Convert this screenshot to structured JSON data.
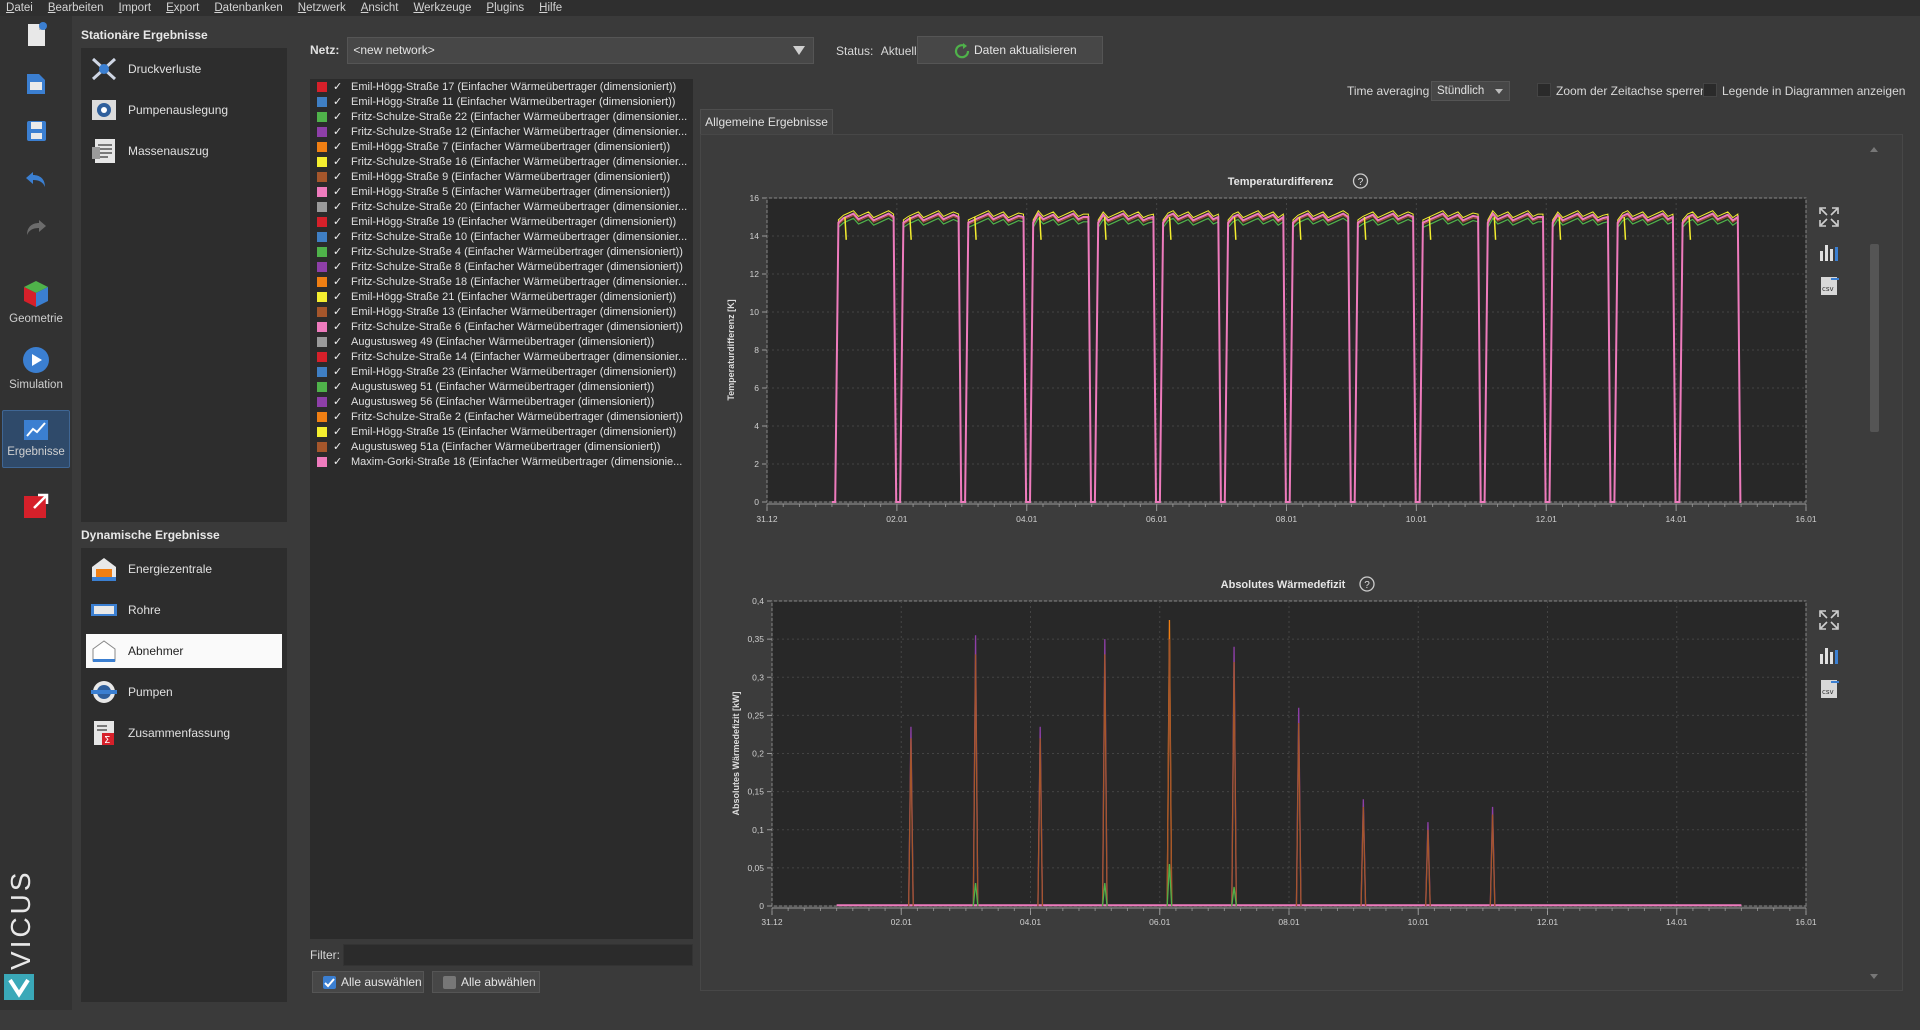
{
  "menu": [
    "Datei",
    "Bearbeiten",
    "Import",
    "Export",
    "Datenbanken",
    "Netzwerk",
    "Ansicht",
    "Werkzeuge",
    "Plugins",
    "Hilfe"
  ],
  "toolbar": {
    "geometry_label": "Geometrie",
    "simulation_label": "Simulation",
    "results_label": "Ergebnisse",
    "logo_text": "VICUS"
  },
  "stationary": {
    "title": "Stationäre Ergebnisse",
    "items": [
      {
        "label": "Druckverluste",
        "icon": "pressure-loss-icon"
      },
      {
        "label": "Pumpenauslegung",
        "icon": "pump-design-icon"
      },
      {
        "label": "Massenauszug",
        "icon": "bill-of-quantities-icon"
      }
    ]
  },
  "dynamic": {
    "title": "Dynamische Ergebnisse",
    "items": [
      {
        "label": "Energiezentrale",
        "icon": "energy-center-icon"
      },
      {
        "label": "Rohre",
        "icon": "pipe-icon"
      },
      {
        "label": "Abnehmer",
        "icon": "consumer-icon",
        "selected": true
      },
      {
        "label": "Pumpen",
        "icon": "pump-icon"
      },
      {
        "label": "Zusammenfassung",
        "icon": "summary-icon"
      }
    ]
  },
  "network": {
    "label": "Netz:",
    "value": "<new network>",
    "status_label": "Status:",
    "status_value": "Aktuell",
    "refresh_label": "Daten aktualisieren"
  },
  "consumers": [
    {
      "name": "Emil-Högg-Straße 17 (Einfacher Wärmeübertrager (dimensioniert))",
      "color": "#d6202a"
    },
    {
      "name": "Emil-Högg-Straße 11 (Einfacher Wärmeübertrager (dimensioniert))",
      "color": "#3f7fc4"
    },
    {
      "name": "Fritz-Schulze-Straße 22 (Einfacher Wärmeübertrager (dimensionier...",
      "color": "#4fb24a"
    },
    {
      "name": "Fritz-Schulze-Straße 12 (Einfacher Wärmeübertrager (dimensionier...",
      "color": "#8e3fa8"
    },
    {
      "name": "Emil-Högg-Straße 7 (Einfacher Wärmeübertrager (dimensioniert))",
      "color": "#f07f13"
    },
    {
      "name": "Fritz-Schulze-Straße 16 (Einfacher Wärmeübertrager (dimensionier...",
      "color": "#f4ee2f"
    },
    {
      "name": "Emil-Högg-Straße 9 (Einfacher Wärmeübertrager (dimensioniert))",
      "color": "#a5562b"
    },
    {
      "name": "Emil-Högg-Straße 5 (Einfacher Wärmeübertrager (dimensioniert))",
      "color": "#ee7bbd"
    },
    {
      "name": "Fritz-Schulze-Straße 20 (Einfacher Wärmeübertrager (dimensionier...",
      "color": "#9a9a9a"
    },
    {
      "name": "Emil-Högg-Straße 19 (Einfacher Wärmeübertrager (dimensioniert))",
      "color": "#d6202a"
    },
    {
      "name": "Fritz-Schulze-Straße 10 (Einfacher Wärmeübertrager (dimensionier...",
      "color": "#3f7fc4"
    },
    {
      "name": "Fritz-Schulze-Straße 4 (Einfacher Wärmeübertrager (dimensioniert))",
      "color": "#4fb24a"
    },
    {
      "name": "Fritz-Schulze-Straße 8 (Einfacher Wärmeübertrager (dimensioniert))",
      "color": "#8e3fa8"
    },
    {
      "name": "Fritz-Schulze-Straße 18 (Einfacher Wärmeübertrager (dimensionier...",
      "color": "#f07f13"
    },
    {
      "name": "Emil-Högg-Straße 21 (Einfacher Wärmeübertrager (dimensioniert))",
      "color": "#f4ee2f"
    },
    {
      "name": "Emil-Högg-Straße 13 (Einfacher Wärmeübertrager (dimensioniert))",
      "color": "#a5562b"
    },
    {
      "name": "Fritz-Schulze-Straße 6 (Einfacher Wärmeübertrager (dimensioniert))",
      "color": "#ee7bbd"
    },
    {
      "name": "Augustusweg 49 (Einfacher Wärmeübertrager (dimensioniert))",
      "color": "#9a9a9a"
    },
    {
      "name": "Fritz-Schulze-Straße 14 (Einfacher Wärmeübertrager (dimensionier...",
      "color": "#d6202a"
    },
    {
      "name": "Emil-Högg-Straße 23 (Einfacher Wärmeübertrager (dimensioniert))",
      "color": "#3f7fc4"
    },
    {
      "name": "Augustusweg 51 (Einfacher Wärmeübertrager (dimensioniert))",
      "color": "#4fb24a"
    },
    {
      "name": "Augustusweg 56 (Einfacher Wärmeübertrager (dimensioniert))",
      "color": "#8e3fa8"
    },
    {
      "name": "Fritz-Schulze-Straße 2 (Einfacher Wärmeübertrager (dimensioniert))",
      "color": "#f07f13"
    },
    {
      "name": "Emil-Högg-Straße 15 (Einfacher Wärmeübertrager (dimensioniert))",
      "color": "#f4ee2f"
    },
    {
      "name": "Augustusweg 51a (Einfacher Wärmeübertrager (dimensioniert))",
      "color": "#a5562b"
    },
    {
      "name": "Maxim-Gorki-Straße 18 (Einfacher Wärmeübertrager (dimensionie...",
      "color": "#ee7bbd"
    }
  ],
  "filter": {
    "label": "Filter:",
    "value": ""
  },
  "buttons": {
    "select_all": "Alle auswählen",
    "deselect_all": "Alle abwählen"
  },
  "options": {
    "time_averaging_label": "Time averaging",
    "time_averaging_value": "Stündlich",
    "zoom_lock_label": "Zoom der Zeitachse sperren",
    "zoom_lock_checked": false,
    "legend_label": "Legende in Diagrammen anzeigen",
    "legend_checked": false
  },
  "tab_label": "Allgemeine Ergebnisse",
  "chart_data": [
    {
      "type": "line",
      "title": "Temperaturdifferenz",
      "ylabel": "Temperaturdifferenz [K]",
      "xlabel": "",
      "ylim": [
        0,
        16
      ],
      "yticks": [
        0,
        2,
        4,
        6,
        8,
        10,
        12,
        14,
        16
      ],
      "xticks": [
        "31.12",
        "02.01",
        "04.01",
        "06.01",
        "08.01",
        "10.01",
        "12.01",
        "14.01",
        "16.01"
      ],
      "xlim_days": [
        0,
        16
      ],
      "grid": true,
      "legend": false,
      "series_style": "daily on-periods of ~15 K from ~06:00 to ~22:00, dropping to 0 K overnight",
      "on_periods_days": [
        [
          1.1,
          1.95
        ],
        [
          2.1,
          2.95
        ],
        [
          3.1,
          3.95
        ],
        [
          4.1,
          4.95
        ],
        [
          5.1,
          5.95
        ],
        [
          6.1,
          6.95
        ],
        [
          7.1,
          7.95
        ],
        [
          8.1,
          8.95
        ],
        [
          9.1,
          9.95
        ],
        [
          10.1,
          10.95
        ],
        [
          11.1,
          11.95
        ],
        [
          12.1,
          12.95
        ],
        [
          13.1,
          13.95
        ],
        [
          14.1,
          14.95
        ]
      ],
      "plateau_value": 15.0
    },
    {
      "type": "line",
      "title": "Absolutes Wärmedefizit",
      "ylabel": "Absolutes Wärmedefizit [kW]",
      "xlabel": "",
      "ylim": [
        0,
        0.4
      ],
      "yticks": [
        0,
        0.05,
        0.1,
        0.15,
        0.2,
        0.25,
        0.3,
        0.35,
        0.4
      ],
      "ytick_labels": [
        "0",
        "0,05",
        "0,1",
        "0,15",
        "0,2",
        "0,25",
        "0,3",
        "0,35",
        "0,4"
      ],
      "xticks": [
        "31.12",
        "02.01",
        "04.01",
        "06.01",
        "08.01",
        "10.01",
        "12.01",
        "14.01",
        "16.01"
      ],
      "xlim_days": [
        0,
        16
      ],
      "grid": true,
      "legend": false,
      "baseline_range_days": [
        1.0,
        15.0
      ],
      "peaks": [
        {
          "day": 2.15,
          "value": 0.235,
          "color": "#8e3fa8"
        },
        {
          "day": 2.15,
          "value": 0.22,
          "color": "#a5562b"
        },
        {
          "day": 3.15,
          "value": 0.355,
          "color": "#8e3fa8"
        },
        {
          "day": 3.15,
          "value": 0.33,
          "color": "#a5562b"
        },
        {
          "day": 3.15,
          "value": 0.03,
          "color": "#4fb24a"
        },
        {
          "day": 4.15,
          "value": 0.235,
          "color": "#8e3fa8"
        },
        {
          "day": 4.15,
          "value": 0.22,
          "color": "#a5562b"
        },
        {
          "day": 5.15,
          "value": 0.35,
          "color": "#8e3fa8"
        },
        {
          "day": 5.15,
          "value": 0.33,
          "color": "#a5562b"
        },
        {
          "day": 5.15,
          "value": 0.03,
          "color": "#4fb24a"
        },
        {
          "day": 6.15,
          "value": 0.375,
          "color": "#f07f13"
        },
        {
          "day": 6.15,
          "value": 0.35,
          "color": "#a5562b"
        },
        {
          "day": 6.15,
          "value": 0.055,
          "color": "#4fb24a"
        },
        {
          "day": 7.15,
          "value": 0.34,
          "color": "#8e3fa8"
        },
        {
          "day": 7.15,
          "value": 0.32,
          "color": "#a5562b"
        },
        {
          "day": 7.15,
          "value": 0.025,
          "color": "#4fb24a"
        },
        {
          "day": 8.15,
          "value": 0.26,
          "color": "#8e3fa8"
        },
        {
          "day": 8.15,
          "value": 0.24,
          "color": "#a5562b"
        },
        {
          "day": 9.15,
          "value": 0.14,
          "color": "#8e3fa8"
        },
        {
          "day": 9.15,
          "value": 0.13,
          "color": "#a5562b"
        },
        {
          "day": 10.15,
          "value": 0.11,
          "color": "#8e3fa8"
        },
        {
          "day": 10.15,
          "value": 0.1,
          "color": "#a5562b"
        },
        {
          "day": 11.15,
          "value": 0.13,
          "color": "#8e3fa8"
        },
        {
          "day": 11.15,
          "value": 0.12,
          "color": "#a5562b"
        }
      ]
    }
  ]
}
